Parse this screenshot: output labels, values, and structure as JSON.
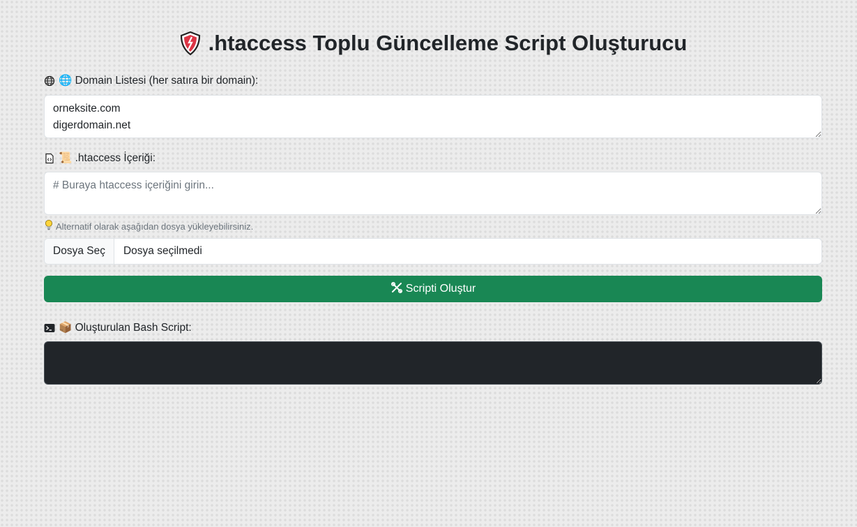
{
  "header": {
    "title": ".htaccess Toplu Güncelleme Script Oluşturucu",
    "icon": "shield-icon"
  },
  "domains": {
    "label": "🌐 Domain Listesi (her satıra bir domain):",
    "value": "orneksite.com\ndigerdomain.net",
    "icon": "globe-icon"
  },
  "htaccess": {
    "label": "📜 .htaccess İçeriği:",
    "placeholder": "# Buraya htaccess içeriğini girin...",
    "value": "",
    "icon": "file-code-icon"
  },
  "hint": {
    "text": "Alternatif olarak aşağıdan dosya yükleyebilirsiniz.",
    "icon": "lightbulb-icon"
  },
  "file_input": {
    "button_label": "Dosya Seç",
    "status": "Dosya seçilmedi"
  },
  "generate_button": {
    "label": "Scripti Oluştur",
    "icon": "tools-icon"
  },
  "output": {
    "label": "📦 Oluşturulan Bash Script:",
    "value": "",
    "icon": "terminal-icon"
  },
  "colors": {
    "primary_button": "#198754",
    "output_background": "#212529",
    "shield_red": "#dc3545"
  }
}
